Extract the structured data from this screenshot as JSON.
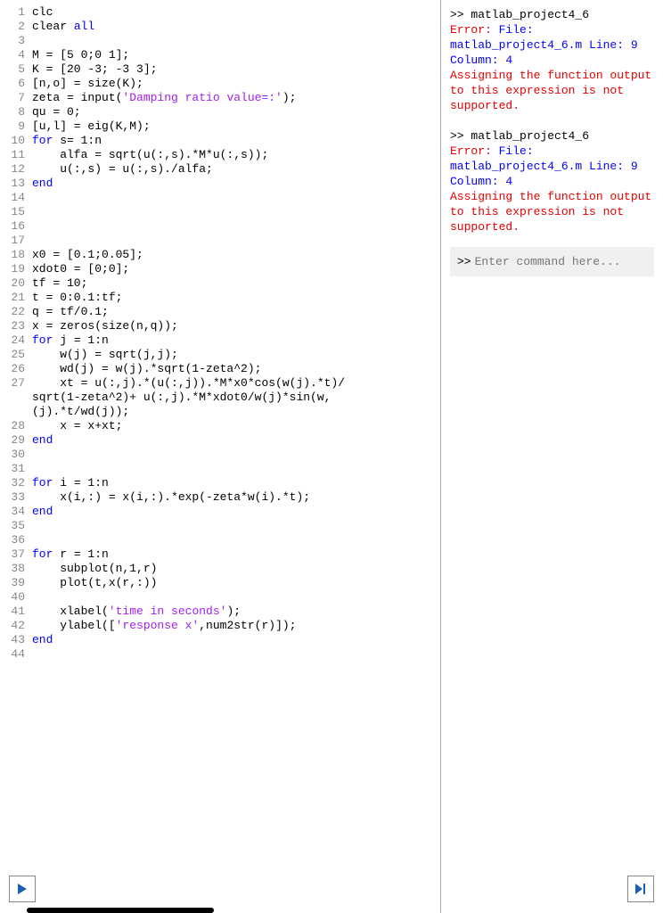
{
  "editor": {
    "lines": [
      {
        "n": 1,
        "segs": [
          {
            "t": "clc",
            "c": "normal"
          }
        ]
      },
      {
        "n": 2,
        "segs": [
          {
            "t": "clear ",
            "c": "normal"
          },
          {
            "t": "all",
            "c": "kw"
          }
        ]
      },
      {
        "n": 3,
        "segs": []
      },
      {
        "n": 4,
        "segs": [
          {
            "t": "M = [5 0;0 1];",
            "c": "normal"
          }
        ]
      },
      {
        "n": 5,
        "segs": [
          {
            "t": "K = [20 -3; -3 3];",
            "c": "normal"
          }
        ]
      },
      {
        "n": 6,
        "segs": [
          {
            "t": "[n,o] = size(K);",
            "c": "normal"
          }
        ]
      },
      {
        "n": 7,
        "segs": [
          {
            "t": "zeta = input(",
            "c": "normal"
          },
          {
            "t": "'Damping ratio value=:'",
            "c": "str"
          },
          {
            "t": ");",
            "c": "normal"
          }
        ]
      },
      {
        "n": 8,
        "segs": [
          {
            "t": "qu = 0;",
            "c": "normal"
          }
        ]
      },
      {
        "n": 9,
        "segs": [
          {
            "t": "[u,l] = eig(K,M);",
            "c": "normal"
          }
        ]
      },
      {
        "n": 10,
        "segs": [
          {
            "t": "for ",
            "c": "kw"
          },
          {
            "t": "s= 1:n",
            "c": "normal"
          }
        ]
      },
      {
        "n": 11,
        "segs": [
          {
            "t": "    alfa = sqrt(u(:,s).*M*u(:,s));",
            "c": "normal"
          }
        ]
      },
      {
        "n": 12,
        "segs": [
          {
            "t": "    u(:,s) = u(:,s)./alfa;",
            "c": "normal"
          }
        ]
      },
      {
        "n": 13,
        "segs": [
          {
            "t": "end",
            "c": "kw"
          }
        ]
      },
      {
        "n": 14,
        "segs": []
      },
      {
        "n": 15,
        "segs": []
      },
      {
        "n": 16,
        "segs": []
      },
      {
        "n": 17,
        "segs": []
      },
      {
        "n": 18,
        "segs": [
          {
            "t": "x0 = [0.1;0.05];",
            "c": "normal"
          }
        ]
      },
      {
        "n": 19,
        "segs": [
          {
            "t": "xdot0 = [0;0];",
            "c": "normal"
          }
        ]
      },
      {
        "n": 20,
        "segs": [
          {
            "t": "tf = 10;",
            "c": "normal"
          }
        ]
      },
      {
        "n": 21,
        "segs": [
          {
            "t": "t = 0:0.1:tf;",
            "c": "normal"
          }
        ]
      },
      {
        "n": 22,
        "segs": [
          {
            "t": "q = tf/0.1;",
            "c": "normal"
          }
        ]
      },
      {
        "n": 23,
        "segs": [
          {
            "t": "x = zeros(size(n,q));",
            "c": "normal"
          }
        ]
      },
      {
        "n": 24,
        "segs": [
          {
            "t": "for ",
            "c": "kw"
          },
          {
            "t": "j = 1:n",
            "c": "normal"
          }
        ]
      },
      {
        "n": 25,
        "segs": [
          {
            "t": "    w(j) = sqrt(j,j);",
            "c": "normal"
          }
        ]
      },
      {
        "n": 26,
        "segs": [
          {
            "t": "    wd(j) = w(j).*sqrt(1-zeta^2);",
            "c": "normal"
          }
        ]
      },
      {
        "n": 27,
        "segs": [
          {
            "t": "    xt = u(:,j).*(u(:,j)).*M*x0*cos(w(j).*t)/",
            "c": "normal"
          }
        ],
        "wrap": [
          {
            "t": "sqrt(1-zeta^2)+ u(:,j).*M*xdot0/w(j)*sin(w,",
            "c": "normal"
          },
          {
            "t": "(j).*t/wd(j));",
            "c": "normal"
          }
        ]
      },
      {
        "n": 28,
        "segs": [
          {
            "t": "    x = x+xt;",
            "c": "normal"
          }
        ]
      },
      {
        "n": 29,
        "segs": [
          {
            "t": "end",
            "c": "kw"
          }
        ]
      },
      {
        "n": 30,
        "segs": []
      },
      {
        "n": 31,
        "segs": []
      },
      {
        "n": 32,
        "segs": [
          {
            "t": "for ",
            "c": "kw"
          },
          {
            "t": "i = 1:n",
            "c": "normal"
          }
        ]
      },
      {
        "n": 33,
        "segs": [
          {
            "t": "    x(i,:) = x(i,:).*exp(-zeta*w(i).*t);",
            "c": "normal"
          }
        ]
      },
      {
        "n": 34,
        "segs": [
          {
            "t": "end",
            "c": "kw"
          }
        ]
      },
      {
        "n": 35,
        "segs": []
      },
      {
        "n": 36,
        "segs": []
      },
      {
        "n": 37,
        "segs": [
          {
            "t": "for ",
            "c": "kw"
          },
          {
            "t": "r = 1:n",
            "c": "normal"
          }
        ]
      },
      {
        "n": 38,
        "segs": [
          {
            "t": "    subplot(n,1,r)",
            "c": "normal"
          }
        ]
      },
      {
        "n": 39,
        "segs": [
          {
            "t": "    plot(t,x(r,:))",
            "c": "normal"
          }
        ]
      },
      {
        "n": 40,
        "segs": []
      },
      {
        "n": 41,
        "segs": [
          {
            "t": "    xlabel(",
            "c": "normal"
          },
          {
            "t": "'time in seconds'",
            "c": "str"
          },
          {
            "t": ");",
            "c": "normal"
          }
        ]
      },
      {
        "n": 42,
        "segs": [
          {
            "t": "    ylabel([",
            "c": "normal"
          },
          {
            "t": "'response x'",
            "c": "str"
          },
          {
            "t": ",num2str(r)]);",
            "c": "normal"
          }
        ]
      },
      {
        "n": 43,
        "segs": [
          {
            "t": "end",
            "c": "kw"
          }
        ]
      },
      {
        "n": 44,
        "segs": []
      }
    ]
  },
  "console": {
    "blocks": [
      [
        {
          "t": ">> ",
          "c": "prompt"
        },
        {
          "t": "matlab_project4_6",
          "c": "normal"
        },
        {
          "br": true
        },
        {
          "t": "Error: ",
          "c": "err-red"
        },
        {
          "t": "File: matlab_project4_6.m Line: 9 Column: 4",
          "c": "err-blue"
        },
        {
          "br": true
        },
        {
          "t": "Assigning the function output to this expression is not supported.",
          "c": "err-red"
        }
      ],
      [
        {
          "t": ">> ",
          "c": "prompt"
        },
        {
          "t": "matlab_project4_6",
          "c": "normal"
        },
        {
          "br": true
        },
        {
          "t": "Error: ",
          "c": "err-red"
        },
        {
          "t": "File: matlab_project4_6.m Line: 9 Column: 4",
          "c": "err-blue"
        },
        {
          "br": true
        },
        {
          "t": "Assigning the function output to this expression is not supported.",
          "c": "err-red"
        }
      ]
    ],
    "input_prompt": ">>",
    "input_placeholder": "Enter command here..."
  }
}
